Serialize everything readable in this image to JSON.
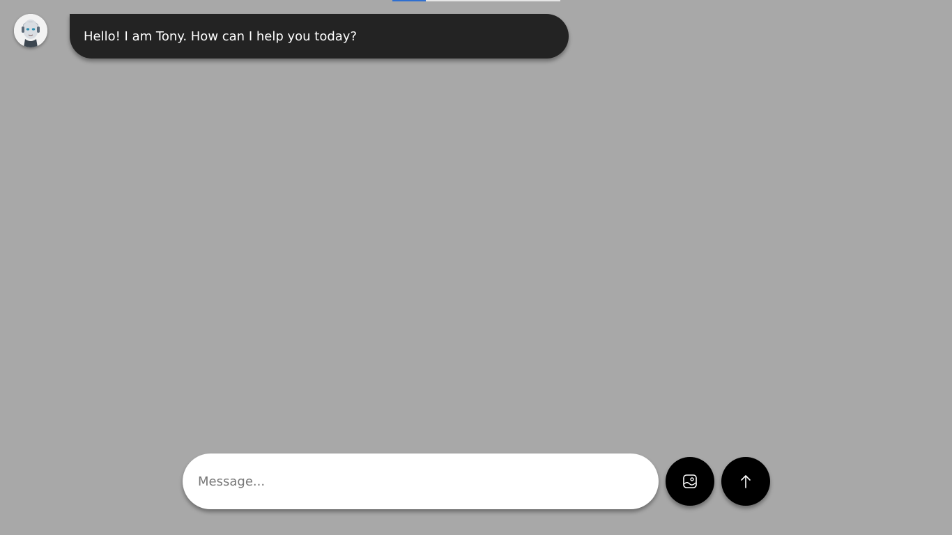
{
  "progress": {
    "fraction": 0.2
  },
  "chat": {
    "assistant_avatar_icon": "robot-avatar-icon",
    "messages": [
      {
        "role": "assistant",
        "text": "Hello! I am Tony. How can I help you today?"
      }
    ]
  },
  "composer": {
    "placeholder": "Message...",
    "value": "",
    "image_button_icon": "image-upload-icon",
    "send_button_icon": "arrow-up-icon"
  },
  "colors": {
    "background": "#a8a8a8",
    "bubble": "#232323",
    "button": "#000000",
    "progress_fill": "#2f6fd0"
  }
}
